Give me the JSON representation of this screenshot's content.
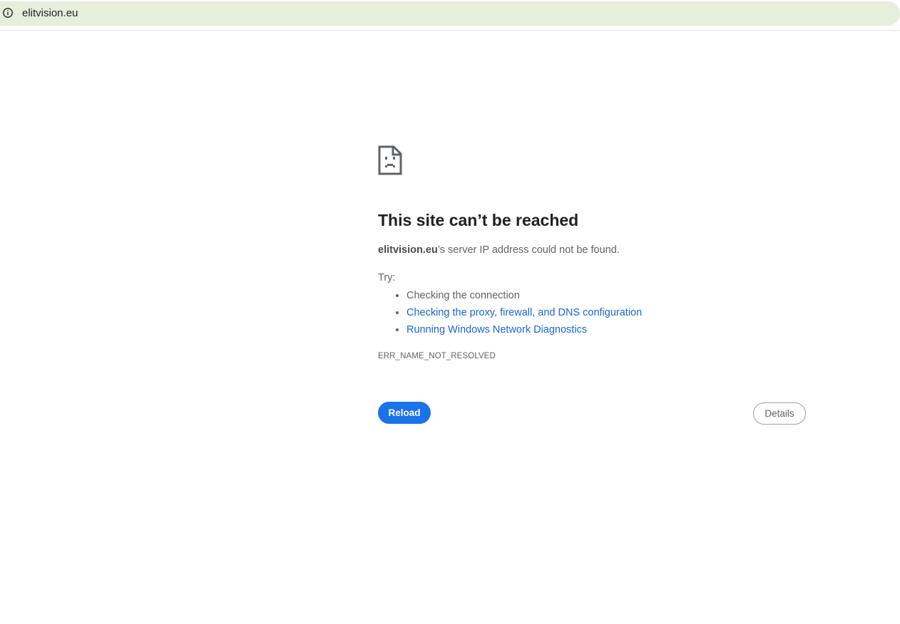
{
  "address_bar": {
    "url": "elitvision.eu",
    "site_info_icon": "info-circle-icon"
  },
  "error_page": {
    "icon": "sad-page-icon",
    "title": "This site can’t be reached",
    "host": "elitvision.eu",
    "summary_rest": "’s server IP address could not be found.",
    "try_label": "Try:",
    "suggestions": [
      {
        "label": "Checking the connection",
        "is_link": false
      },
      {
        "label": "Checking the proxy, firewall, and DNS configuration",
        "is_link": true
      },
      {
        "label": "Running Windows Network Diagnostics",
        "is_link": true
      }
    ],
    "error_code": "ERR_NAME_NOT_RESOLVED",
    "reload_label": "Reload",
    "details_label": "Details"
  },
  "colors": {
    "omnibox_bg": "#e6eedc",
    "primary_button": "#1a73e8",
    "link": "#1a67d2",
    "title_text": "#202124",
    "body_text": "#5f6368"
  }
}
